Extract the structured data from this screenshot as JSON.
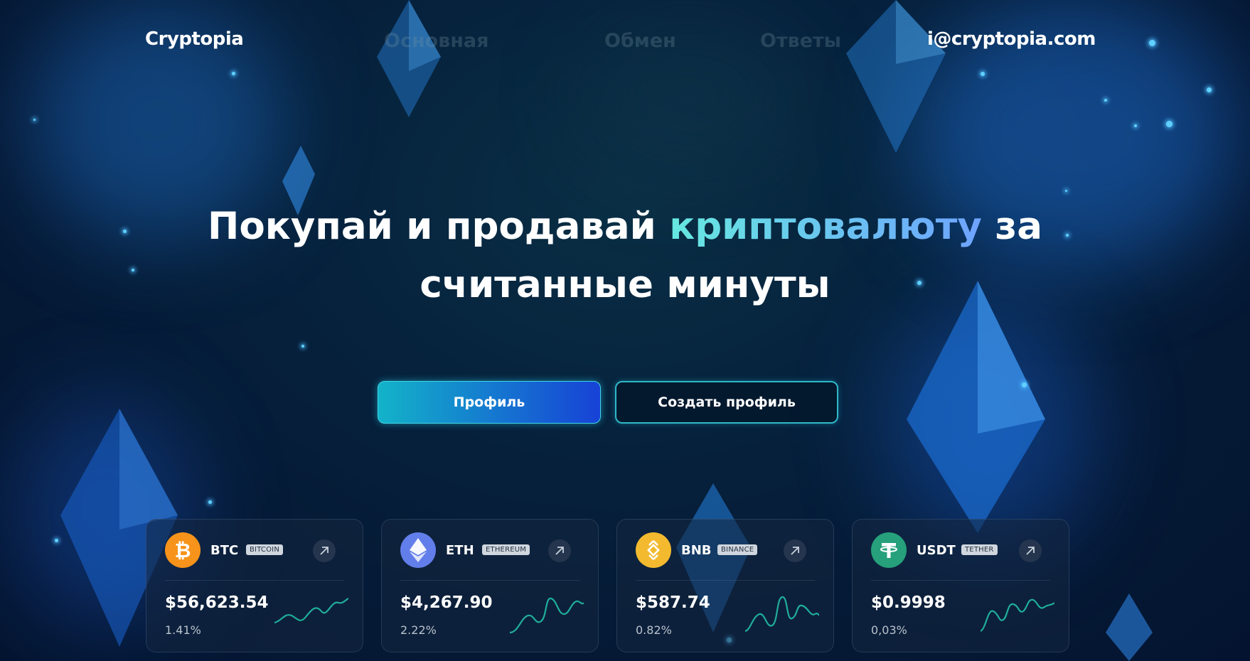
{
  "nav": {
    "brand": "Cryptopia",
    "links": [
      "Основная",
      "Обмен",
      "Ответы"
    ],
    "email": "i@cryptopia.com"
  },
  "hero": {
    "line1_part1": "Покупай и продавай ",
    "line1_accent": "криптовалюту",
    "line1_part2": " за",
    "line2": "считанные минуты"
  },
  "buttons": {
    "primary": "Профиль",
    "secondary": "Создать профиль"
  },
  "cards": [
    {
      "symbol": "BTC",
      "name": "BITCOIN",
      "price": "$56,623.54",
      "change": "1.41%",
      "color": "#f7931a",
      "icon": "bitcoin-icon"
    },
    {
      "symbol": "ETH",
      "name": "ETHEREUM",
      "price": "$4,267.90",
      "change": "2.22%",
      "color": "#627eea",
      "icon": "ethereum-icon"
    },
    {
      "symbol": "BNB",
      "name": "BINANCE",
      "price": "$587.74",
      "change": "0.82%",
      "color": "#f3ba2f",
      "icon": "binance-icon"
    },
    {
      "symbol": "USDT",
      "name": "TETHER",
      "price": "$0.9998",
      "change": "0,03%",
      "color": "#26a17b",
      "icon": "tether-icon"
    }
  ],
  "colors": {
    "accent_cyan": "#66e8e0",
    "accent_blue": "#6ea3ff",
    "sparkline": "#1fae9a"
  }
}
